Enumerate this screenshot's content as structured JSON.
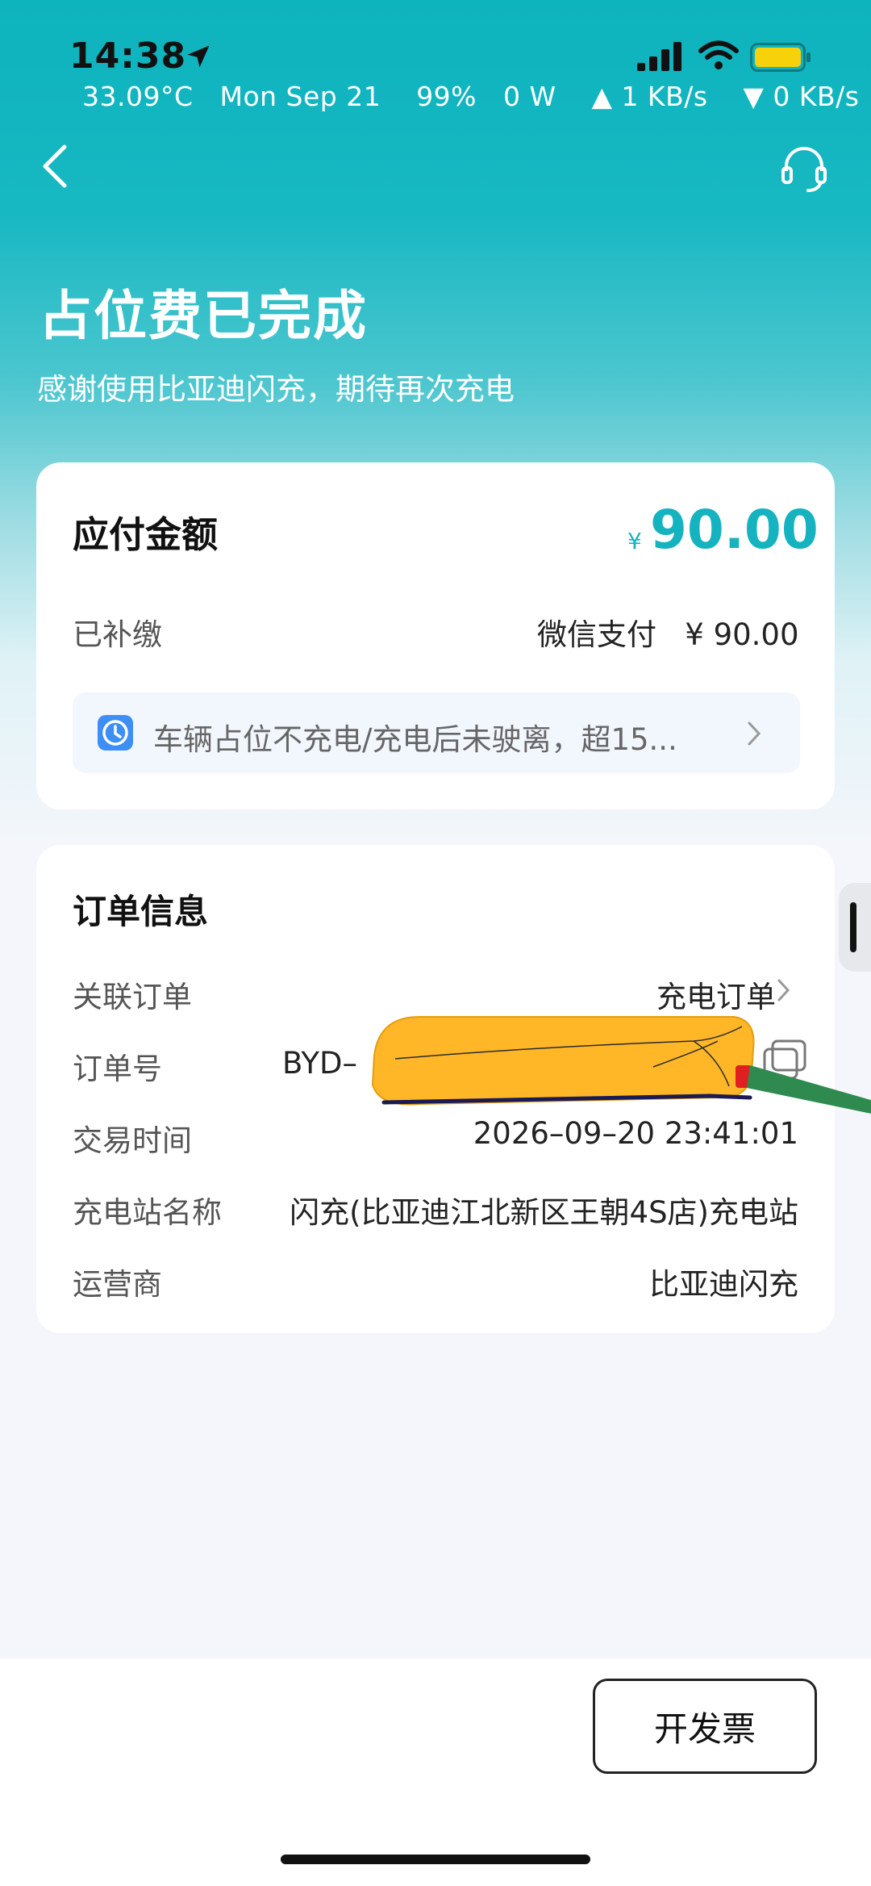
{
  "status_bar": {
    "time": "14:38",
    "info": "33.09°C   Mon Sep 21    99%   0 W    ▲ 1 KB/s    ▼ 0 KB/s"
  },
  "header": {
    "title": "占位费已完成",
    "subtitle": "感谢使用比亚迪闪充，期待再次充电"
  },
  "payment": {
    "label": "应付金额",
    "currency": "¥",
    "amount": "90.00",
    "paid_label": "已补缴",
    "paid_method": "微信支付   ¥ 90.00",
    "notice": "车辆占位不充电/充电后未驶离，超15..."
  },
  "order": {
    "title": "订单信息",
    "rows": [
      {
        "label": "关联订单",
        "value": "充电订单"
      },
      {
        "label": "订单号",
        "value": "BYD–"
      },
      {
        "label": "交易时间",
        "value": "2026–09–20 23:41:01"
      },
      {
        "label": "充电站名称",
        "value": "闪充(比亚迪江北新区王朝4S店)充电站"
      },
      {
        "label": "运营商",
        "value": "比亚迪闪充"
      }
    ]
  },
  "footer": {
    "invoice_button": "开发票"
  },
  "colors": {
    "accent": "#15b3bf",
    "header_gradient_top": "#0db3bd",
    "page_bg": "#f4f6fb"
  }
}
